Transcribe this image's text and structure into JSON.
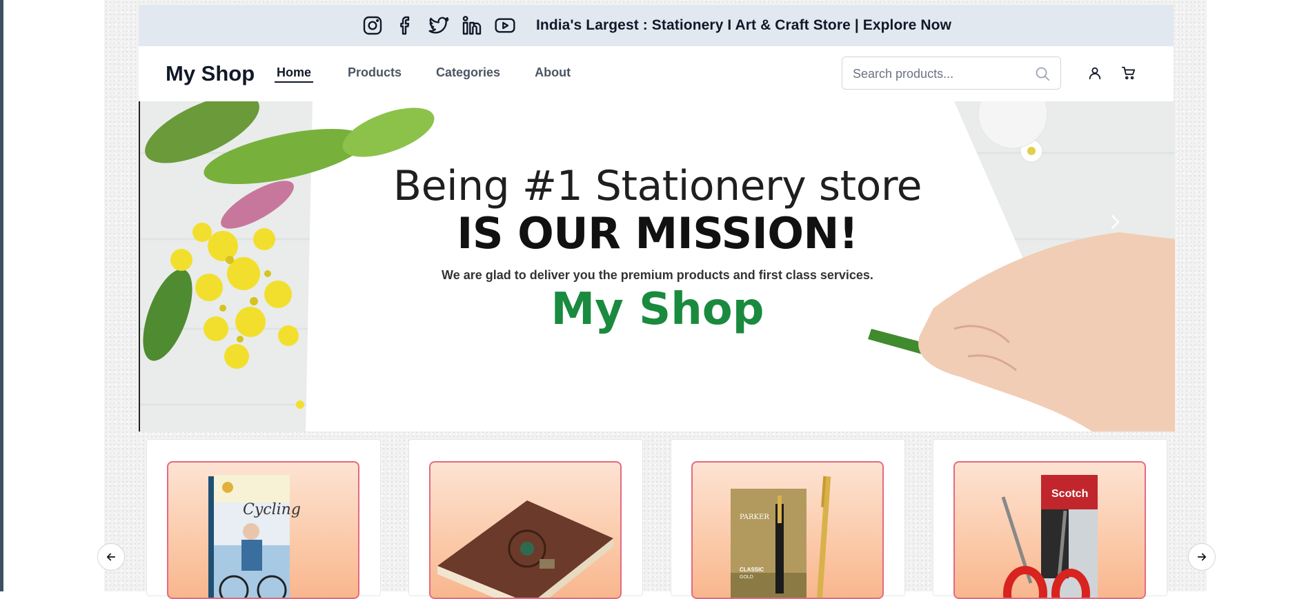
{
  "topbar": {
    "social_icons": [
      "instagram-icon",
      "facebook-icon",
      "twitter-icon",
      "linkedin-icon",
      "youtube-icon"
    ],
    "announcement": "India's Largest : Stationery I Art & Craft Store | Explore Now"
  },
  "navbar": {
    "logo": "My Shop",
    "links": [
      {
        "label": "Home",
        "active": true
      },
      {
        "label": "Products",
        "active": false
      },
      {
        "label": "Categories",
        "active": false
      },
      {
        "label": "About",
        "active": false
      }
    ],
    "search_placeholder": "Search products...",
    "icons": [
      "search-icon",
      "user-icon",
      "cart-icon"
    ]
  },
  "hero": {
    "line1": "Being #1 Stationery store",
    "line2": "IS OUR MISSION!",
    "subtitle": "We are glad to deliver you the premium products and first class services.",
    "brand": "My Shop",
    "brand_color": "#1a8a3e"
  },
  "products": [
    {
      "name": "cycling-notebook"
    },
    {
      "name": "leather-journal"
    },
    {
      "name": "parker-pen"
    },
    {
      "name": "scotch-scissors"
    }
  ],
  "colors": {
    "topbar_bg": "#e2e8f0",
    "card_border": "#e36a81",
    "text_dark": "#111827"
  }
}
